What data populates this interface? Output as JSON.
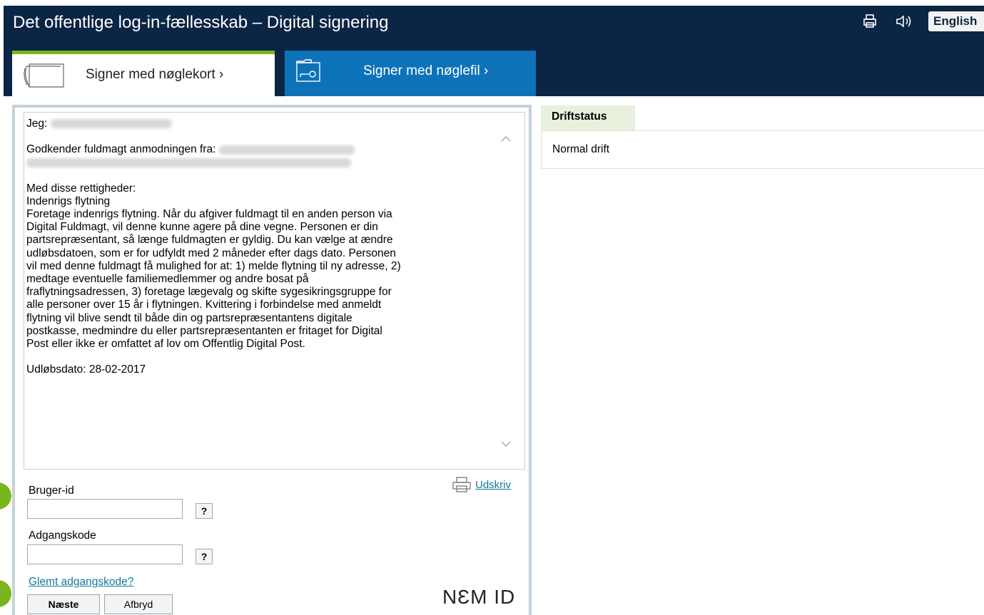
{
  "header": {
    "title": "Det offentlige log-in-fællesskab – Digital signering",
    "print_icon": "print-icon",
    "sound_icon": "speaker-icon",
    "language_label": "English"
  },
  "tabs": [
    {
      "label": "Signer med nøglekort",
      "chevron": "›",
      "icon": "key-card-icon",
      "active": true
    },
    {
      "label": "Signer med nøglefil",
      "chevron": "›",
      "icon": "key-file-icon",
      "active": false
    }
  ],
  "consent": {
    "me_label": "Jeg:",
    "approve_label": "Godkender fuldmagt anmodningen fra:",
    "rights_label": "Med disse rettigheder:",
    "right_title": "Indenrigs flytning",
    "lines": [
      "Foretage indenrigs flytning. Når du afgiver fuldmagt til en anden person via",
      "Digital Fuldmagt, vil denne kunne agere på dine vegne. Personen er din",
      "partsrepræsentant, så længe fuldmagten er gyldig. Du kan vælge at ændre",
      "udløbsdatoen, som er for udfyldt med 2 måneder efter dags dato. Personen",
      "vil med denne fuldmagt få mulighed for at: 1) melde flytning til ny adresse, 2)",
      "medtage eventuelle familiemedlemmer og andre bosat på",
      "fraflytningsadressen, 3) foretage lægevalg og skifte sygesikringsgruppe for",
      "alle personer over 15 år i flytningen. Kvittering i forbindelse med anmeldt",
      "flytning vil blive sendt til både din og partsrepræsentantens digitale",
      "postkasse, medmindre du eller partsrepræsentanten er fritaget for Digital",
      "Post eller ikke er omfattet af lov om Offentlig Digital Post."
    ],
    "expiry": "Udløbsdato: 28-02-2017"
  },
  "print": {
    "label": "Udskriv",
    "icon": "print-icon"
  },
  "form": {
    "user_id_label": "Bruger-id",
    "user_id_value": "",
    "password_label": "Adgangskode",
    "password_value": "",
    "help_label": "?",
    "forgot_label": "Glemt adgangskode?",
    "next_label": "Næste",
    "cancel_label": "Afbryd",
    "logo_text": "NƐM ID"
  },
  "status": {
    "tab_label": "Driftstatus",
    "text": "Normal drift"
  },
  "colors": {
    "header_bg": "#0b2545",
    "tab_inactive_bg": "#0e72b8",
    "accent_green": "#7ab51d",
    "link": "#0e7a9a"
  }
}
